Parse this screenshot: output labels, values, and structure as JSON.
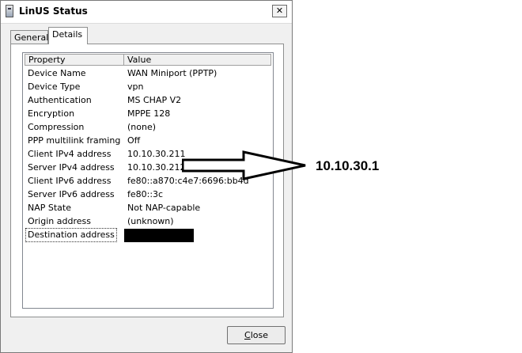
{
  "window": {
    "title": "LinUS Status",
    "close_glyph": "✕"
  },
  "tabs": [
    {
      "label": "General",
      "active": false
    },
    {
      "label": "Details",
      "active": true
    }
  ],
  "table": {
    "columns": [
      "Property",
      "Value"
    ],
    "rows": [
      {
        "property": "Device Name",
        "value": "WAN Miniport (PPTP)"
      },
      {
        "property": "Device Type",
        "value": "vpn"
      },
      {
        "property": "Authentication",
        "value": "MS CHAP V2"
      },
      {
        "property": "Encryption",
        "value": "MPPE 128"
      },
      {
        "property": "Compression",
        "value": "(none)"
      },
      {
        "property": "PPP multilink framing",
        "value": "Off"
      },
      {
        "property": "Client IPv4 address",
        "value": "10.10.30.211"
      },
      {
        "property": "Server IPv4 address",
        "value": "10.10.30.212"
      },
      {
        "property": "Client IPv6 address",
        "value": "fe80::a870:c4e7:6696:bb4d"
      },
      {
        "property": "Server IPv6 address",
        "value": "fe80::3c"
      },
      {
        "property": "NAP State",
        "value": "Not NAP-capable"
      },
      {
        "property": "Origin address",
        "value": "(unknown)"
      },
      {
        "property": "Destination address",
        "value": ""
      }
    ]
  },
  "buttons": {
    "close_label_prefix": "",
    "close_label_mnemonic": "C",
    "close_label_rest": "lose"
  },
  "annotation": {
    "text": "10.10.30.1"
  }
}
